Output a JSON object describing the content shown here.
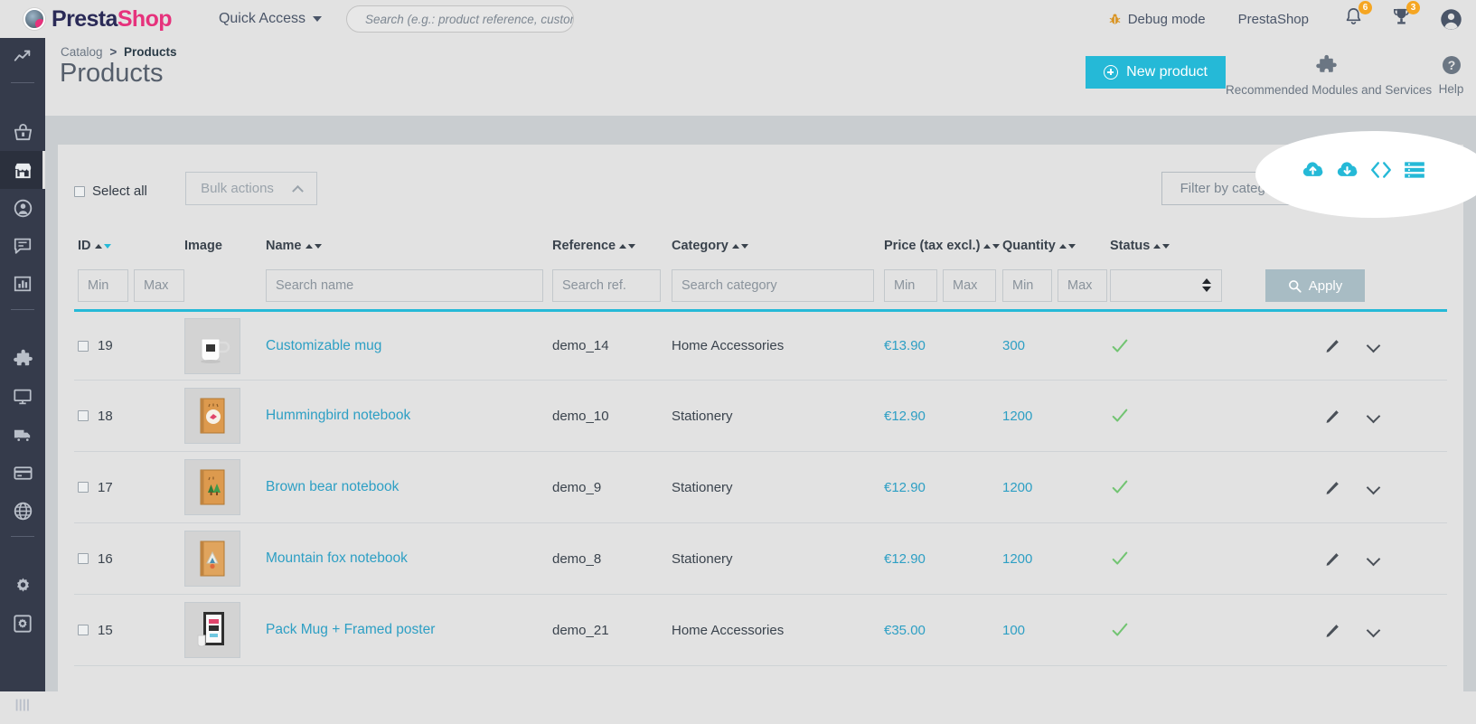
{
  "header": {
    "logo": {
      "part1": "Presta",
      "part2": "Shop",
      "icon": "prestashop-logo-icon"
    },
    "quick_access": "Quick Access",
    "search_placeholder": "Search (e.g.: product reference, custome",
    "debug_mode": "Debug mode",
    "shop_name": "PrestaShop",
    "notifications_count": "6",
    "trophies_count": "3",
    "icons": {
      "bug": "bug-icon",
      "bell": "bell-icon",
      "trophy": "trophy-icon",
      "avatar": "user-avatar-icon",
      "search": "search-icon",
      "caret": "chevron-down-icon"
    }
  },
  "sidebar": {
    "items": [
      {
        "name": "dashboard",
        "icon": "trending-up-icon",
        "active": false
      },
      {
        "name": "orders",
        "icon": "shopping-basket-icon",
        "active": false
      },
      {
        "name": "catalog",
        "icon": "store-icon",
        "active": true
      },
      {
        "name": "customers",
        "icon": "person-icon",
        "active": false
      },
      {
        "name": "customer-service",
        "icon": "speech-bubble-icon",
        "active": false
      },
      {
        "name": "stats",
        "icon": "bar-chart-icon",
        "active": false
      },
      {
        "name": "modules",
        "icon": "puzzle-piece-icon",
        "active": false
      },
      {
        "name": "design",
        "icon": "monitor-icon",
        "active": false
      },
      {
        "name": "shipping",
        "icon": "truck-icon",
        "active": false
      },
      {
        "name": "payment",
        "icon": "credit-card-icon",
        "active": false
      },
      {
        "name": "international",
        "icon": "globe-icon",
        "active": false
      },
      {
        "name": "shop-parameters",
        "icon": "gear-icon",
        "active": false
      },
      {
        "name": "advanced-parameters",
        "icon": "gear-box-icon",
        "active": false
      },
      {
        "name": "collapse-menu",
        "icon": "menu-bars-icon",
        "active": false
      }
    ]
  },
  "page": {
    "breadcrumb_parent": "Catalog",
    "breadcrumb_separator": ">",
    "breadcrumb_current": "Products",
    "title": "Products",
    "new_product_label": "New product",
    "recommended_modules_label": "Recommended Modules and Services",
    "help_label": "Help"
  },
  "toolbar": {
    "select_all_label": "Select all",
    "bulk_actions_label": "Bulk actions",
    "filter_categories_label": "Filter by categories",
    "export_icons": [
      {
        "name": "cloud-upload-icon"
      },
      {
        "name": "cloud-download-icon"
      },
      {
        "name": "code-brackets-icon"
      },
      {
        "name": "list-view-icon"
      }
    ]
  },
  "table": {
    "columns": [
      {
        "key": "id",
        "label": "ID",
        "sortable": true,
        "sort_active": "desc"
      },
      {
        "key": "image",
        "label": "Image",
        "sortable": false
      },
      {
        "key": "name",
        "label": "Name",
        "sortable": true
      },
      {
        "key": "reference",
        "label": "Reference",
        "sortable": true
      },
      {
        "key": "category",
        "label": "Category",
        "sortable": true
      },
      {
        "key": "price",
        "label": "Price (tax excl.)",
        "sortable": true
      },
      {
        "key": "quantity",
        "label": "Quantity",
        "sortable": true
      },
      {
        "key": "status",
        "label": "Status",
        "sortable": true
      }
    ],
    "filters": {
      "id_min": "Min",
      "id_max": "Max",
      "name": "Search name",
      "reference": "Search ref.",
      "category": "Search category",
      "price_min": "Min",
      "price_max": "Max",
      "qty_min": "Min",
      "qty_max": "Max",
      "status_value": "",
      "apply_label": "Apply"
    },
    "rows": [
      {
        "id": "19",
        "image": "customizable-mug",
        "name": "Customizable mug",
        "reference": "demo_14",
        "category": "Home Accessories",
        "price": "€13.90",
        "quantity": "300",
        "status": "enabled"
      },
      {
        "id": "18",
        "image": "hummingbird-notebook",
        "name": "Hummingbird notebook",
        "reference": "demo_10",
        "category": "Stationery",
        "price": "€12.90",
        "quantity": "1200",
        "status": "enabled"
      },
      {
        "id": "17",
        "image": "brown-bear-notebook",
        "name": "Brown bear notebook",
        "reference": "demo_9",
        "category": "Stationery",
        "price": "€12.90",
        "quantity": "1200",
        "status": "enabled"
      },
      {
        "id": "16",
        "image": "mountain-fox-notebook",
        "name": "Mountain fox notebook",
        "reference": "demo_8",
        "category": "Stationery",
        "price": "€12.90",
        "quantity": "1200",
        "status": "enabled"
      },
      {
        "id": "15",
        "image": "pack-mug-framed-poster",
        "name": "Pack Mug + Framed poster",
        "reference": "demo_21",
        "category": "Home Accessories",
        "price": "€35.00",
        "quantity": "100",
        "status": "enabled"
      }
    ]
  },
  "colors": {
    "accent": "#25b9d7",
    "brand_pink": "#e6327c",
    "brand_navy": "#2a2a57",
    "sidebar_bg": "#353b4b",
    "link": "#2d9fc4",
    "status_ok": "#72c472",
    "badge": "#f5a623",
    "apply_button": "#a8bcc4"
  }
}
